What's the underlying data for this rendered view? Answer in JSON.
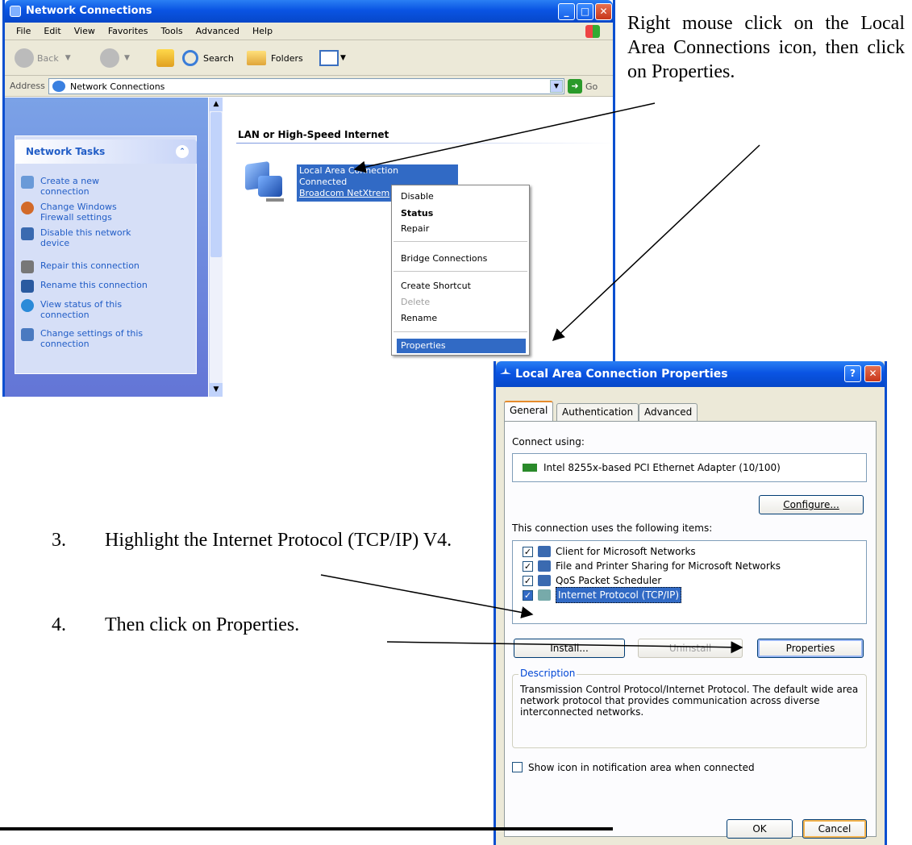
{
  "network_window": {
    "title": "Network Connections",
    "menu": [
      "File",
      "Edit",
      "View",
      "Favorites",
      "Tools",
      "Advanced",
      "Help"
    ],
    "toolbar": {
      "back": "Back",
      "search": "Search",
      "folders": "Folders"
    },
    "address_label": "Address",
    "address_value": "Network Connections",
    "go": "Go",
    "tasks_title": "Network Tasks",
    "tasks": [
      [
        "Create a new",
        "connection"
      ],
      [
        "Change Windows",
        "Firewall settings"
      ],
      [
        "Disable this network",
        "device"
      ],
      [
        "Repair this connection"
      ],
      [
        "Rename this connection"
      ],
      [
        "View status of this",
        "connection"
      ],
      [
        "Change settings of this",
        "connection"
      ]
    ],
    "section_header": "LAN or High-Speed Internet",
    "connection": {
      "name": "Local Area Connection",
      "status": "Connected",
      "device": "Broadcom NetXtrem"
    },
    "context_menu": [
      "Disable",
      "Status",
      "Repair",
      "Bridge Connections",
      "Create Shortcut",
      "Delete",
      "Rename",
      "Properties"
    ]
  },
  "instructions": {
    "step_right_click": "Right mouse click on the Local Area Connections icon, then click on Properties.",
    "step3_num": "3.",
    "step3_text": "Highlight the Internet Protocol (TCP/IP) V4.",
    "step4_num": "4.",
    "step4_text": "Then click on Properties."
  },
  "dialog": {
    "title": "Local Area Connection Properties",
    "tabs": [
      "General",
      "Authentication",
      "Advanced"
    ],
    "connect_using_label": "Connect using:",
    "adapter": "Intel 8255x-based PCI Ethernet Adapter (10/100)",
    "configure": "Configure...",
    "items_label": "This connection uses the following items:",
    "items": [
      "Client for Microsoft Networks",
      "File and Printer Sharing for Microsoft Networks",
      "QoS Packet Scheduler",
      "Internet Protocol (TCP/IP)"
    ],
    "install": "Install...",
    "uninstall": "Uninstall",
    "properties": "Properties",
    "description_label": "Description",
    "description_text": "Transmission Control Protocol/Internet Protocol. The default wide area network protocol that provides communication across diverse interconnected networks.",
    "show_icon": "Show icon in notification area when connected",
    "ok": "OK",
    "cancel": "Cancel"
  }
}
